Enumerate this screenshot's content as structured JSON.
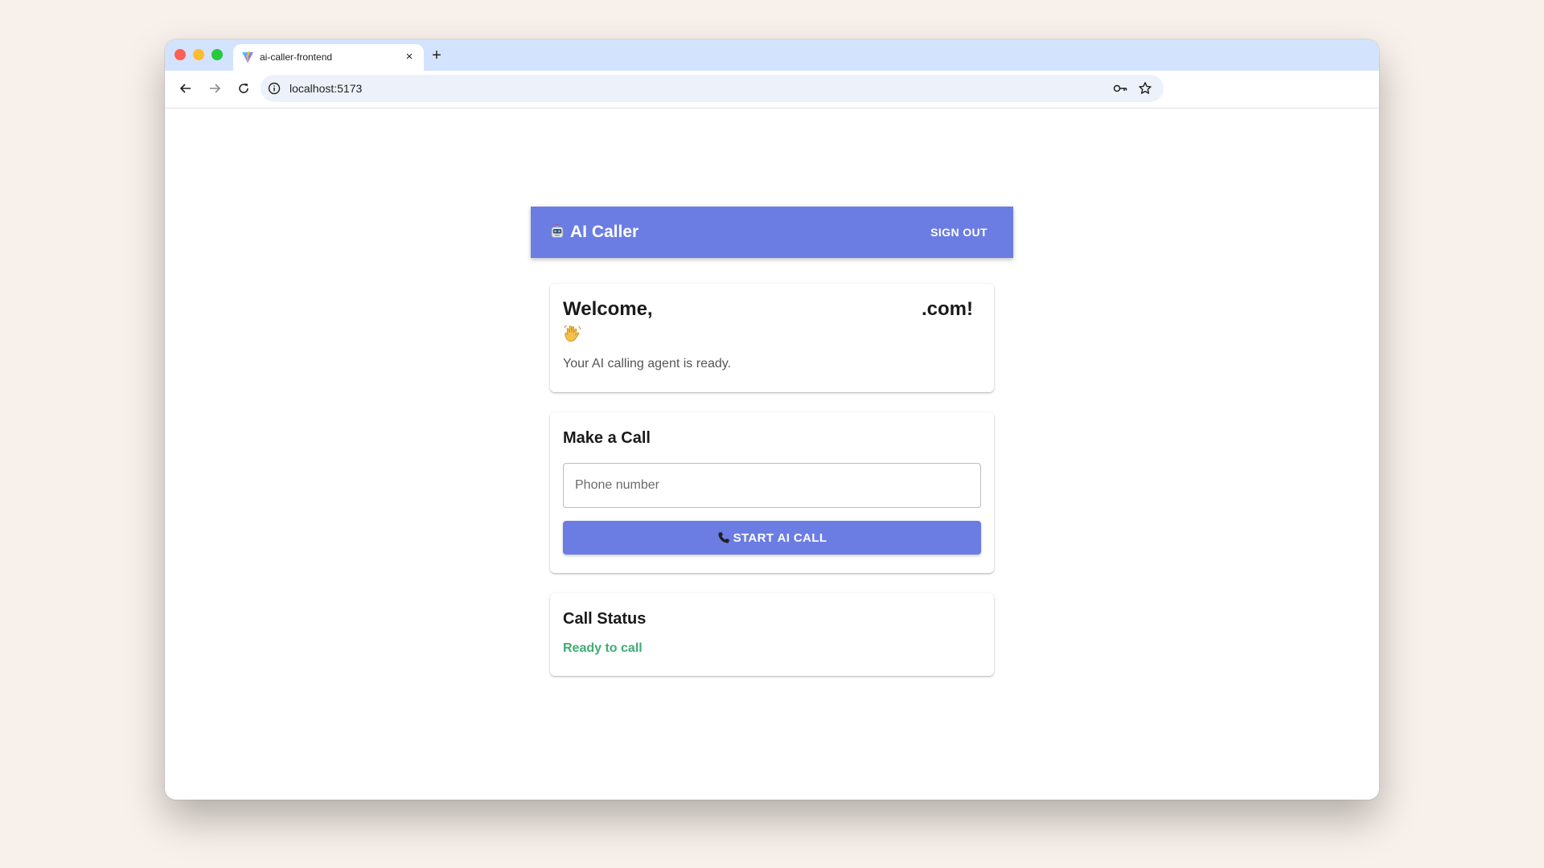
{
  "browser": {
    "tab_title": "ai-caller-frontend",
    "url": "localhost:5173",
    "close_glyph": "×",
    "new_tab_glyph": "+"
  },
  "app": {
    "title": "AI Caller",
    "title_icon": "robot-icon",
    "sign_out_label": "SIGN OUT",
    "accent_color": "#6b7de3"
  },
  "welcome": {
    "greeting_left": "Welcome,",
    "greeting_right": ".com!",
    "wave_icon": "waving-hand-icon",
    "subtitle": "Your AI calling agent is ready."
  },
  "make_call": {
    "heading": "Make a Call",
    "phone_placeholder": "Phone number",
    "phone_value": "",
    "start_button_label": "START AI CALL",
    "start_button_icon": "phone-icon"
  },
  "call_status": {
    "heading": "Call Status",
    "status_text": "Ready to call",
    "status_color": "#3fad73"
  }
}
